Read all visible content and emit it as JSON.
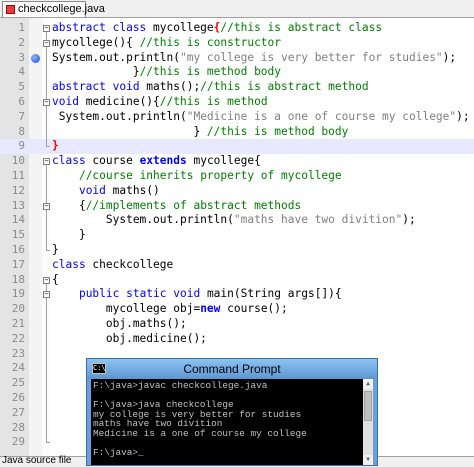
{
  "tab": {
    "label": "checkcollege.java"
  },
  "status": {
    "text": "Java source file"
  },
  "colors": {
    "keyword": "#0000ff",
    "comment": "#008000",
    "string": "#808080",
    "brace_highlight": "#ff0000",
    "current_line": "#e8e8ff"
  },
  "editor": {
    "lines": [
      {
        "num": "1",
        "tokens": [
          {
            "t": "abstract class",
            "c": "kw"
          },
          {
            "t": " mycollege",
            "c": ""
          },
          {
            "t": "{",
            "c": "brace-red"
          },
          {
            "t": "//this is abstract class",
            "c": "cmt"
          }
        ]
      },
      {
        "num": "2",
        "tokens": [
          {
            "t": "mycollege(){ ",
            "c": ""
          },
          {
            "t": "//this is constructor",
            "c": "cmt"
          }
        ]
      },
      {
        "num": "3",
        "tokens": [
          {
            "t": "System.out.println(",
            "c": ""
          },
          {
            "t": "\"my college is very better for studies\"",
            "c": "str"
          },
          {
            "t": ");",
            "c": ""
          }
        ]
      },
      {
        "num": "4",
        "tokens": [
          {
            "t": "            }",
            "c": ""
          },
          {
            "t": "//this is method body",
            "c": "cmt"
          }
        ]
      },
      {
        "num": "5",
        "tokens": [
          {
            "t": "abstract void",
            "c": "kw"
          },
          {
            "t": " maths();",
            "c": ""
          },
          {
            "t": "//this is abstract method",
            "c": "cmt"
          }
        ]
      },
      {
        "num": "6",
        "tokens": [
          {
            "t": "void",
            "c": "kw"
          },
          {
            "t": " medicine(){",
            "c": ""
          },
          {
            "t": "//this is method",
            "c": "cmt"
          }
        ]
      },
      {
        "num": "7",
        "tokens": [
          {
            "t": " System.out.println(",
            "c": ""
          },
          {
            "t": "\"Medicine is a one of course my college\"",
            "c": "str"
          },
          {
            "t": ");",
            "c": ""
          }
        ]
      },
      {
        "num": "8",
        "tokens": [
          {
            "t": "                     } ",
            "c": ""
          },
          {
            "t": "//this is method body",
            "c": "cmt"
          }
        ]
      },
      {
        "num": "9",
        "tokens": [
          {
            "t": "}",
            "c": "brace-red"
          }
        ]
      },
      {
        "num": "10",
        "tokens": [
          {
            "t": "class",
            "c": "kw"
          },
          {
            "t": " course ",
            "c": ""
          },
          {
            "t": "extends",
            "c": "kwb"
          },
          {
            "t": " mycollege{",
            "c": ""
          }
        ]
      },
      {
        "num": "11",
        "tokens": [
          {
            "t": "    ",
            "c": ""
          },
          {
            "t": "//course inherits property of mycollege",
            "c": "cmt"
          }
        ]
      },
      {
        "num": "12",
        "tokens": [
          {
            "t": "    ",
            "c": ""
          },
          {
            "t": "void",
            "c": "kw"
          },
          {
            "t": " maths()",
            "c": ""
          }
        ]
      },
      {
        "num": "13",
        "tokens": [
          {
            "t": "    {",
            "c": ""
          },
          {
            "t": "//implements of abstract methods",
            "c": "cmt"
          }
        ]
      },
      {
        "num": "14",
        "tokens": [
          {
            "t": "        System.out.println(",
            "c": ""
          },
          {
            "t": "\"maths have two divition\"",
            "c": "str"
          },
          {
            "t": ");",
            "c": ""
          }
        ]
      },
      {
        "num": "15",
        "tokens": [
          {
            "t": "    }",
            "c": ""
          }
        ]
      },
      {
        "num": "16",
        "tokens": [
          {
            "t": "}",
            "c": ""
          }
        ]
      },
      {
        "num": "17",
        "tokens": [
          {
            "t": "class",
            "c": "kw"
          },
          {
            "t": " checkcollege",
            "c": ""
          }
        ]
      },
      {
        "num": "18",
        "tokens": [
          {
            "t": "{",
            "c": ""
          }
        ]
      },
      {
        "num": "19",
        "tokens": [
          {
            "t": "    ",
            "c": ""
          },
          {
            "t": "public static void",
            "c": "kw"
          },
          {
            "t": " main(String args[]){",
            "c": ""
          }
        ]
      },
      {
        "num": "20",
        "tokens": [
          {
            "t": "        mycollege obj=",
            "c": ""
          },
          {
            "t": "new",
            "c": "kwb"
          },
          {
            "t": " course();",
            "c": ""
          }
        ]
      },
      {
        "num": "21",
        "tokens": [
          {
            "t": "        obj.maths();",
            "c": ""
          }
        ]
      },
      {
        "num": "22",
        "tokens": [
          {
            "t": "        obj.medicine();",
            "c": ""
          }
        ]
      },
      {
        "num": "23",
        "tokens": [
          {
            "t": "",
            "c": ""
          }
        ]
      },
      {
        "num": "24",
        "tokens": [
          {
            "t": "",
            "c": ""
          }
        ]
      },
      {
        "num": "25",
        "tokens": [
          {
            "t": "",
            "c": ""
          }
        ]
      },
      {
        "num": "26",
        "tokens": [
          {
            "t": "",
            "c": ""
          }
        ]
      },
      {
        "num": "27",
        "tokens": [
          {
            "t": "",
            "c": ""
          }
        ]
      },
      {
        "num": "28",
        "tokens": [
          {
            "t": "",
            "c": ""
          }
        ]
      },
      {
        "num": "29",
        "tokens": [
          {
            "t": "",
            "c": ""
          }
        ]
      }
    ],
    "breakpoint_line": "3",
    "current_line": "9"
  },
  "cmd": {
    "title": "Command Prompt",
    "icon": "cmd-window-icon",
    "lines": [
      "F:\\java>javac checkcollege.java",
      "",
      "F:\\java>java checkcollege",
      "my college is very better for studies",
      "maths have two divition",
      "Medicine is a one of course my college",
      "",
      "F:\\java>_"
    ]
  }
}
